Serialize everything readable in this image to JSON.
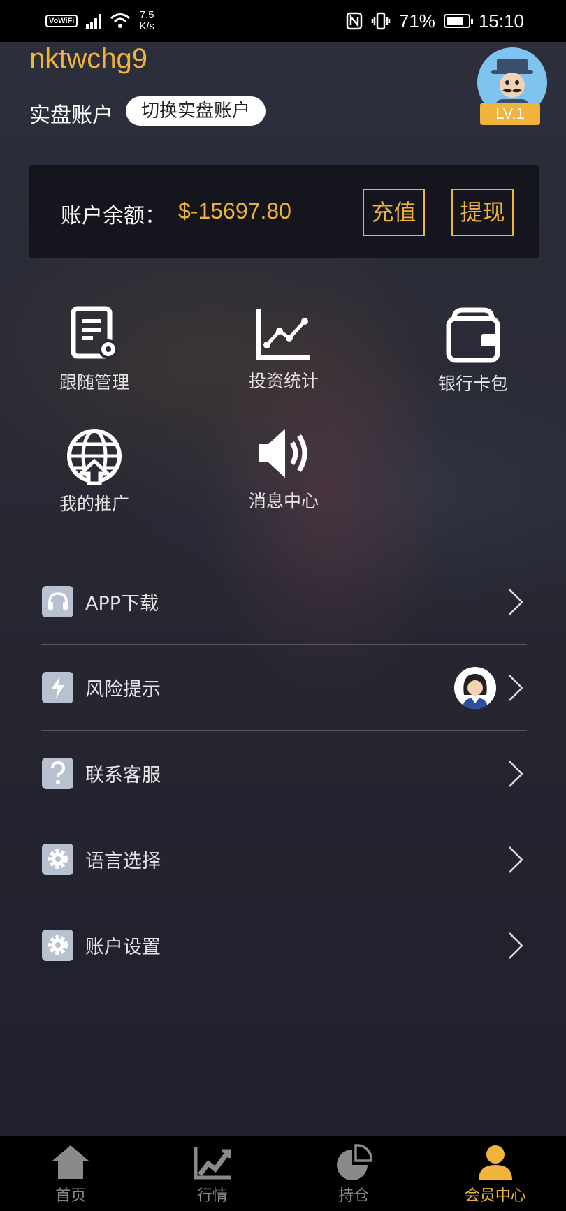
{
  "status_bar": {
    "vowifi": "VoWiFi",
    "net_speed_value": "7.5",
    "net_speed_unit": "K/s",
    "battery_percent": "71%",
    "time": "15:10"
  },
  "profile": {
    "username": "nktwchg9",
    "account_type": "实盘账户",
    "switch_label": "切换实盘账户",
    "level": "LV.1"
  },
  "balance": {
    "label": "账户余额：",
    "value": "$-15697.80",
    "deposit_label": "充值",
    "withdraw_label": "提现"
  },
  "grid": [
    {
      "label": "跟随管理",
      "icon": "document-gear-icon"
    },
    {
      "label": "投资统计",
      "icon": "line-chart-icon"
    },
    {
      "label": "银行卡包",
      "icon": "wallet-icon"
    },
    {
      "label": "我的推广",
      "icon": "globe-icon"
    },
    {
      "label": "消息中心",
      "icon": "speaker-icon"
    }
  ],
  "menu": [
    {
      "label": "APP下载",
      "icon": "headphones-icon"
    },
    {
      "label": "风险提示",
      "icon": "lightning-icon"
    },
    {
      "label": "联系客服",
      "icon": "question-icon"
    },
    {
      "label": "语言选择",
      "icon": "gear-icon"
    },
    {
      "label": "账户设置",
      "icon": "gear-icon"
    }
  ],
  "tabs": [
    {
      "label": "首页",
      "icon": "home-icon"
    },
    {
      "label": "行情",
      "icon": "trend-icon"
    },
    {
      "label": "持仓",
      "icon": "pie-icon"
    },
    {
      "label": "会员中心",
      "icon": "user-icon",
      "active": true
    }
  ],
  "colors": {
    "accent": "#f0b43c",
    "background": "#262631",
    "card": "#15151d",
    "menu_icon_bg": "#b7c1cf"
  }
}
